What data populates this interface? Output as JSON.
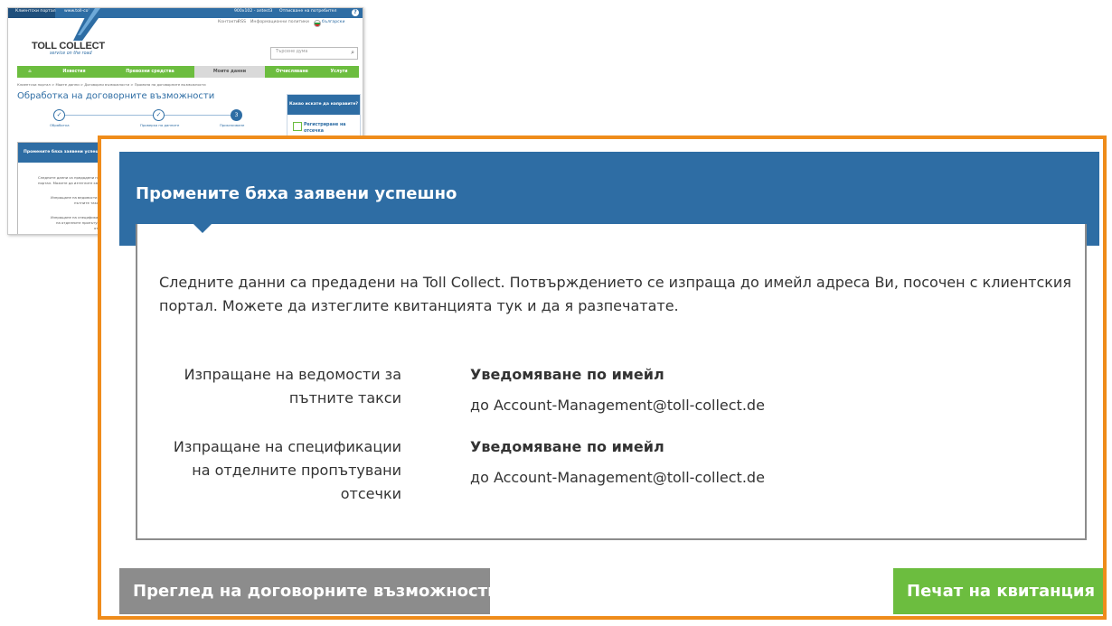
{
  "background_screenshot": {
    "topbar": {
      "tab_label": "Клиентски портал",
      "url": "www.toll-collect.de",
      "user": "900x102 - antest3",
      "logout": "Отписване на потребител",
      "help_icon": "question-icon"
    },
    "links": {
      "contacts": "Контакти",
      "rss": "RSS",
      "info": "Информационни политики",
      "language": "български"
    },
    "logo": {
      "name": "TOLL COLLECT",
      "tagline": "service on the road"
    },
    "search": {
      "placeholder": "Търсене дума",
      "icon": "search-icon"
    },
    "nav": [
      "Известия",
      "Превозни средства",
      "Моите данни",
      "Отчисляване",
      "Услуги"
    ],
    "nav_home_icon": "home-icon",
    "breadcrumb": "Клиентски портал  > Моите данни  > Договорни възможности  > Промяна на договорните възможности",
    "heading": "Обработка на договорните възможности",
    "steps": [
      {
        "label": "Обработка",
        "mark": "✓"
      },
      {
        "label": "Проверка на данните",
        "mark": "✓"
      },
      {
        "label": "Приключване",
        "mark": "3"
      }
    ],
    "sidebar": {
      "title": "Какво искате да направите?",
      "item": "Регистриране на отсечка"
    },
    "mini_card": {
      "title": "Промените бяха заявени успешно",
      "intro_1": "Следните данни са предадени на Toll",
      "intro_2": "портал. Можете да изтеглите квитан",
      "label_1a": "Изпращане на ведомости за",
      "label_1b": "пътните такси",
      "label_2a": "Изпращане на спецификации",
      "label_2b": "на отделните пропътувани",
      "label_2c": "отсечки"
    }
  },
  "card": {
    "title": "Промените бяха заявени успешно",
    "intro": "Следните данни са предадени на Toll Collect. Потвърждението се изпраща до имейл адреса Ви, посочен с клиентския портал. Можете да изтеглите квитанцията тук и да я разпечатате.",
    "rows": [
      {
        "label_lines": [
          "Изпращане на ведомости за",
          "пътните такси"
        ],
        "method": "Уведомяване по имейл",
        "recipient": "до Account-Management@toll-collect.de"
      },
      {
        "label_lines": [
          "Изпращане на спецификации",
          "на отделните пропътувани",
          "отсечки"
        ],
        "method": "Уведомяване по имейл",
        "recipient": "до Account-Management@toll-collect.de"
      }
    ]
  },
  "buttons": {
    "overview": "Преглед на договорните възможности",
    "print": "Печат на квитанция"
  },
  "colors": {
    "primary_blue": "#2e6da4",
    "green": "#6cbd3f",
    "grey_button": "#8c8c8c",
    "highlight_border": "#ef8c1b"
  }
}
